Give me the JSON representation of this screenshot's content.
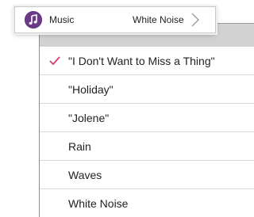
{
  "preference": {
    "label": "Music",
    "value": "White Noise",
    "icon": "music-note-icon"
  },
  "options": [
    {
      "label": "\"I Don't Want to Miss a Thing\"",
      "selected": true
    },
    {
      "label": "\"Holiday\"",
      "selected": false
    },
    {
      "label": "\"Jolene\"",
      "selected": false
    },
    {
      "label": "Rain",
      "selected": false
    },
    {
      "label": "Waves",
      "selected": false
    },
    {
      "label": "White Noise",
      "selected": false
    }
  ],
  "colors": {
    "check": "#d83a66",
    "icon_bg": "#6a3a86",
    "header_bg": "#d2d2d2"
  }
}
